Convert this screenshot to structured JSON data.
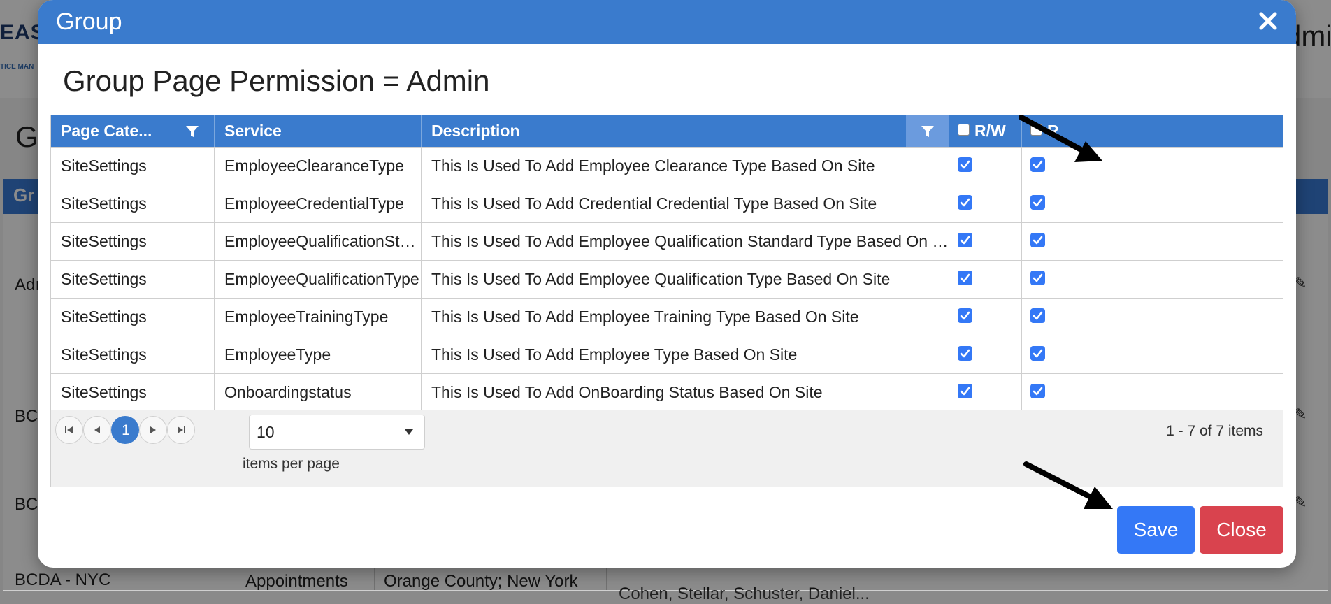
{
  "background": {
    "logo_text": "EAS",
    "logo_subtext": "TICE MAN",
    "user_text": "dmi",
    "page_title": "G",
    "grid_header": "Gr",
    "rows": [
      {
        "text": "Adı"
      },
      {
        "text": "BC"
      },
      {
        "text": "BC"
      },
      {
        "text": "BCDA - NYC",
        "col2": "Appointments",
        "col3": "Orange County; New York",
        "col4": "Cohen, Stellar, Schuster, Daniel..."
      }
    ]
  },
  "modal": {
    "title": "Group",
    "close_icon": "close-icon",
    "permission_title": "Group Page Permission = Admin",
    "columns": {
      "page_category": "Page Cate...",
      "service": "Service",
      "description": "Description",
      "rw": "R/W",
      "r": "R"
    },
    "rows": [
      {
        "category": "SiteSettings",
        "service": "EmployeeClearanceType",
        "description": "This Is Used To Add Employee Clearance Type Based On Site",
        "rw": true,
        "r": true
      },
      {
        "category": "SiteSettings",
        "service": "EmployeeCredentialType",
        "description": "This Is Used To Add Credential Credential Type Based On Site",
        "rw": true,
        "r": true
      },
      {
        "category": "SiteSettings",
        "service": "EmployeeQualificationStand...",
        "description": "This Is Used To Add Employee Qualification Standard Type Based On Site",
        "rw": true,
        "r": true
      },
      {
        "category": "SiteSettings",
        "service": "EmployeeQualificationType",
        "description": "This Is Used To Add Employee Qualification Type Based On Site",
        "rw": true,
        "r": true
      },
      {
        "category": "SiteSettings",
        "service": "EmployeeTrainingType",
        "description": "This Is Used To Add Employee Training Type Based On Site",
        "rw": true,
        "r": true
      },
      {
        "category": "SiteSettings",
        "service": "EmployeeType",
        "description": "This Is Used To Add Employee Type Based On Site",
        "rw": true,
        "r": true
      },
      {
        "category": "SiteSettings",
        "service": "Onboardingstatus",
        "description": "This Is Used To Add OnBoarding Status Based On Site",
        "rw": true,
        "r": true
      }
    ],
    "pager": {
      "current_page": "1",
      "page_size": "10",
      "items_per_page_label": "items per page",
      "info": "1 - 7 of 7 items"
    },
    "buttons": {
      "save": "Save",
      "close": "Close"
    },
    "colors": {
      "header_blue": "#3a7bcd",
      "primary": "#3478f6",
      "danger": "#d9434e"
    }
  }
}
